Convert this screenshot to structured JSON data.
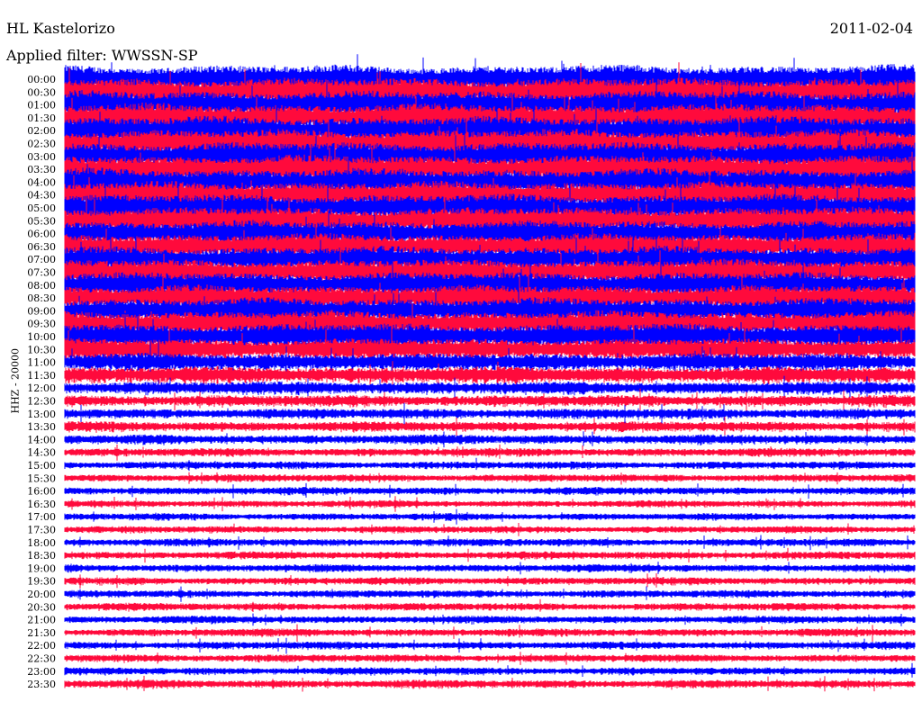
{
  "chart_data": {
    "type": "line",
    "title": "HL Kastelorizo",
    "date": "2011-02-04",
    "subtitle": "Applied filter: WWSSN-SP",
    "ylabel": "HHZ - 20000",
    "colors": [
      "#0000ff",
      "#ff0a3c"
    ],
    "row_labels": [
      "00:00",
      "00:30",
      "01:00",
      "01:30",
      "02:00",
      "02:30",
      "03:00",
      "03:30",
      "04:00",
      "04:30",
      "05:00",
      "05:30",
      "06:00",
      "06:30",
      "07:00",
      "07:30",
      "08:00",
      "08:30",
      "09:00",
      "09:30",
      "10:00",
      "10:30",
      "11:00",
      "11:30",
      "12:00",
      "12:30",
      "13:00",
      "13:30",
      "14:00",
      "14:30",
      "15:00",
      "15:30",
      "16:00",
      "16:30",
      "17:00",
      "17:30",
      "18:00",
      "18:30",
      "19:00",
      "19:30",
      "20:00",
      "20:30",
      "21:00",
      "21:30",
      "22:00",
      "22:30",
      "23:00",
      "23:30"
    ],
    "relative_amplitude": [
      2.2,
      2.2,
      2.2,
      2.2,
      2.2,
      2.2,
      2.2,
      2.2,
      2.1,
      2.1,
      2.1,
      2.1,
      2.0,
      2.0,
      2.0,
      2.0,
      2.0,
      2.0,
      2.0,
      2.0,
      2.0,
      1.7,
      1.4,
      1.3,
      1.0,
      0.9,
      0.8,
      0.8,
      0.75,
      0.65,
      0.6,
      0.6,
      0.6,
      0.55,
      0.55,
      0.55,
      0.6,
      0.6,
      0.6,
      0.6,
      0.6,
      0.6,
      0.6,
      0.6,
      0.6,
      0.6,
      0.6,
      0.65
    ]
  }
}
